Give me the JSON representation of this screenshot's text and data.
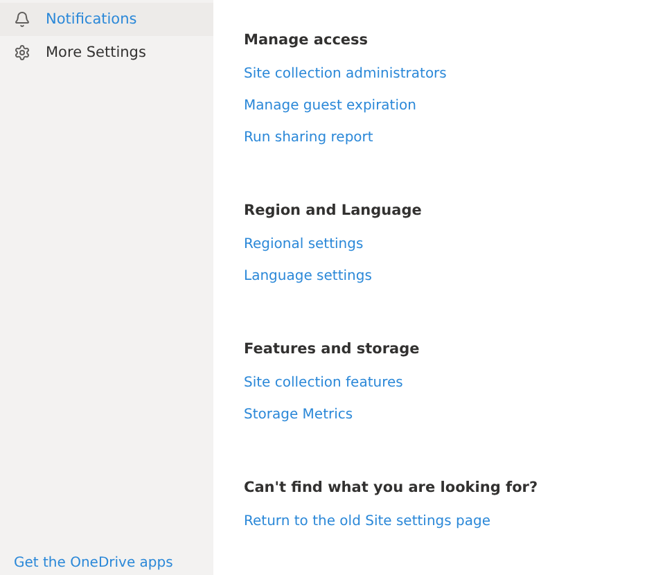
{
  "sidebar": {
    "items": [
      {
        "label": "Notifications",
        "selected": true
      },
      {
        "label": "More Settings",
        "selected": false
      }
    ],
    "footer_link": "Get the OneDrive apps"
  },
  "sections": [
    {
      "heading": "Manage access",
      "links": [
        "Site collection administrators",
        "Manage guest expiration",
        "Run sharing report"
      ]
    },
    {
      "heading": "Region and Language",
      "links": [
        "Regional settings",
        "Language settings"
      ]
    },
    {
      "heading": "Features and storage",
      "links": [
        "Site collection features",
        "Storage Metrics"
      ]
    },
    {
      "heading": "Can't find what you are looking for?",
      "links": [
        "Return to the old Site settings page"
      ]
    }
  ]
}
